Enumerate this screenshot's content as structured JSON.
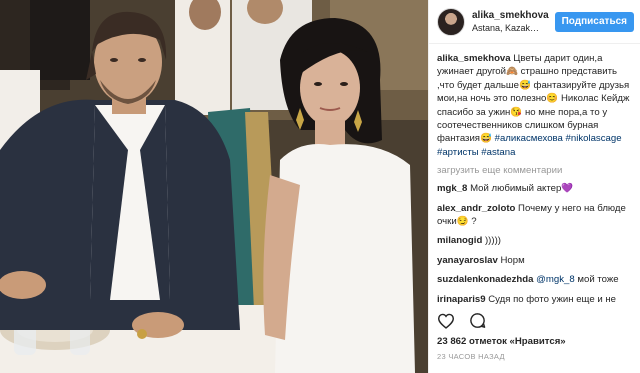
{
  "post": {
    "username": "alika_smekhova",
    "location": "Astana, Kazak…",
    "follow_label": "Подписаться"
  },
  "caption": {
    "author": "alika_smekhova",
    "text": "Цветы дарит один,а ужинает другой🙈 страшно представить ,что будет дальше😅 фантазируйте друзья мои,на ночь это полезно😊 Николас Кейдж спасибо за ужин😘 но мне пора,а то у соотечественников слишком бурная фантазия😅",
    "tags": "#аликасмехова #nikolascage #артисты #astana"
  },
  "load_more_label": "загрузить еще комментарии",
  "comments": [
    {
      "author": "mgk_8",
      "text": "Мой любимый актер💜",
      "mention": ""
    },
    {
      "author": "alex_andr_zoloto",
      "text": "Почему у него на блюде очки😏 ?",
      "mention": ""
    },
    {
      "author": "milanogid",
      "text": ")))))",
      "mention": ""
    },
    {
      "author": "yanayaroslav",
      "text": "Норм",
      "mention": ""
    },
    {
      "author": "suzdalenkonadezhda",
      "text": "мой тоже",
      "mention": "@mgk_8"
    },
    {
      "author": "irinaparis9",
      "text": "Судя по фото ужин еще и не начинался. И очки на тарелочке выглядя",
      "mention": ""
    }
  ],
  "likes": "23 862 отметок «Нравится»",
  "time": "23 ЧАСОВ НАЗАД",
  "icons": [
    "heart-icon",
    "comment-icon"
  ],
  "colors": {
    "follow": "#3897f0",
    "link": "#003569",
    "muted": "#999999"
  }
}
